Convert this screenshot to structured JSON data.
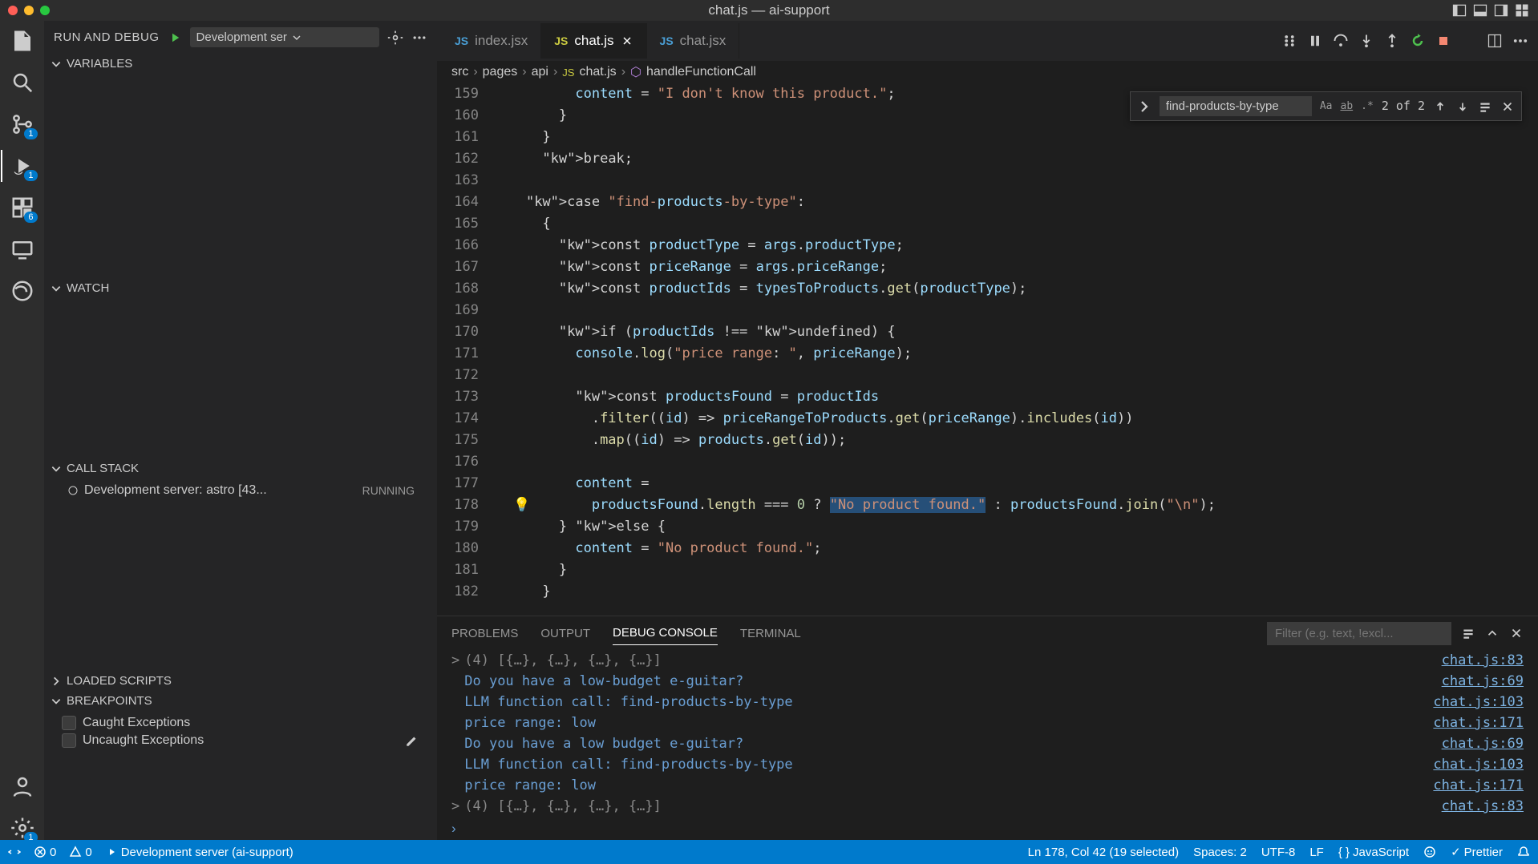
{
  "window": {
    "title": "chat.js — ai-support"
  },
  "sidebar": {
    "run_debug_label": "RUN AND DEBUG",
    "config": "Development ser",
    "sections": {
      "variables": "VARIABLES",
      "watch": "WATCH",
      "callstack": "CALL STACK",
      "loaded": "LOADED SCRIPTS",
      "breakpoints": "BREAKPOINTS"
    },
    "callstack_item": "Development server: astro [43...",
    "callstack_status": "RUNNING",
    "breakpoints": {
      "caught": "Caught Exceptions",
      "uncaught": "Uncaught Exceptions"
    },
    "activity_badges": {
      "scm": "1",
      "debug": "1",
      "ext": "6"
    }
  },
  "tabs": [
    {
      "name": "index.jsx",
      "icon": "jsx"
    },
    {
      "name": "chat.js",
      "icon": "js",
      "active": true
    },
    {
      "name": "chat.jsx",
      "icon": "jsx"
    }
  ],
  "breadcrumb": {
    "p0": "src",
    "p1": "pages",
    "p2": "api",
    "p3": "chat.js",
    "p4": "handleFunctionCall"
  },
  "find": {
    "query": "find-products-by-type",
    "count": "2 of 2"
  },
  "code_lines": [
    {
      "n": 159,
      "t": "          content = \"I don't know this product.\";"
    },
    {
      "n": 160,
      "t": "        }"
    },
    {
      "n": 161,
      "t": "      }"
    },
    {
      "n": 162,
      "t": "      break;"
    },
    {
      "n": 163,
      "t": ""
    },
    {
      "n": 164,
      "t": "    case \"find-products-by-type\":"
    },
    {
      "n": 165,
      "t": "      {"
    },
    {
      "n": 166,
      "t": "        const productType = args.productType;"
    },
    {
      "n": 167,
      "t": "        const priceRange = args.priceRange;"
    },
    {
      "n": 168,
      "t": "        const productIds = typesToProducts.get(productType);"
    },
    {
      "n": 169,
      "t": ""
    },
    {
      "n": 170,
      "t": "        if (productIds !== undefined) {"
    },
    {
      "n": 171,
      "t": "          console.log(\"price range: \", priceRange);"
    },
    {
      "n": 172,
      "t": ""
    },
    {
      "n": 173,
      "t": "          const productsFound = productIds"
    },
    {
      "n": 174,
      "t": "            .filter((id) => priceRangeToProducts.get(priceRange).includes(id))"
    },
    {
      "n": 175,
      "t": "            .map((id) => products.get(id));"
    },
    {
      "n": 176,
      "t": ""
    },
    {
      "n": 177,
      "t": "          content ="
    },
    {
      "n": 178,
      "t": "            productsFound.length === 0 ? \"No product found.\" : productsFound.join(\"\\n\");"
    },
    {
      "n": 179,
      "t": "        } else {"
    },
    {
      "n": 180,
      "t": "          content = \"No product found.\";"
    },
    {
      "n": 181,
      "t": "        }"
    },
    {
      "n": 182,
      "t": "      }"
    }
  ],
  "panel": {
    "tabs": {
      "problems": "PROBLEMS",
      "output": "OUTPUT",
      "debug": "DEBUG CONSOLE",
      "terminal": "TERMINAL"
    },
    "filter_placeholder": "Filter (e.g. text, !excl..."
  },
  "console": [
    {
      "caret": ">",
      "t": "(4) [{…}, {…}, {…}, {…}]",
      "src": "chat.js:83",
      "muted": true
    },
    {
      "t": "Do you have a low-budget e-guitar?",
      "src": "chat.js:69"
    },
    {
      "t": "LLM function call:  find-products-by-type",
      "src": "chat.js:103"
    },
    {
      "t": "price range:  low",
      "src": "chat.js:171"
    },
    {
      "t": "Do you have a low budget e-guitar?",
      "src": "chat.js:69"
    },
    {
      "t": "LLM function call:  find-products-by-type",
      "src": "chat.js:103"
    },
    {
      "t": "price range:  low",
      "src": "chat.js:171"
    },
    {
      "caret": ">",
      "t": "(4) [{…}, {…}, {…}, {…}]",
      "src": "chat.js:83",
      "muted": true
    }
  ],
  "status": {
    "errors": "0",
    "warnings": "0",
    "server": "Development server (ai-support)",
    "cursor": "Ln 178, Col 42 (19 selected)",
    "spaces": "Spaces: 2",
    "encoding": "UTF-8",
    "eol": "LF",
    "lang": "JavaScript",
    "prettier": "Prettier"
  }
}
